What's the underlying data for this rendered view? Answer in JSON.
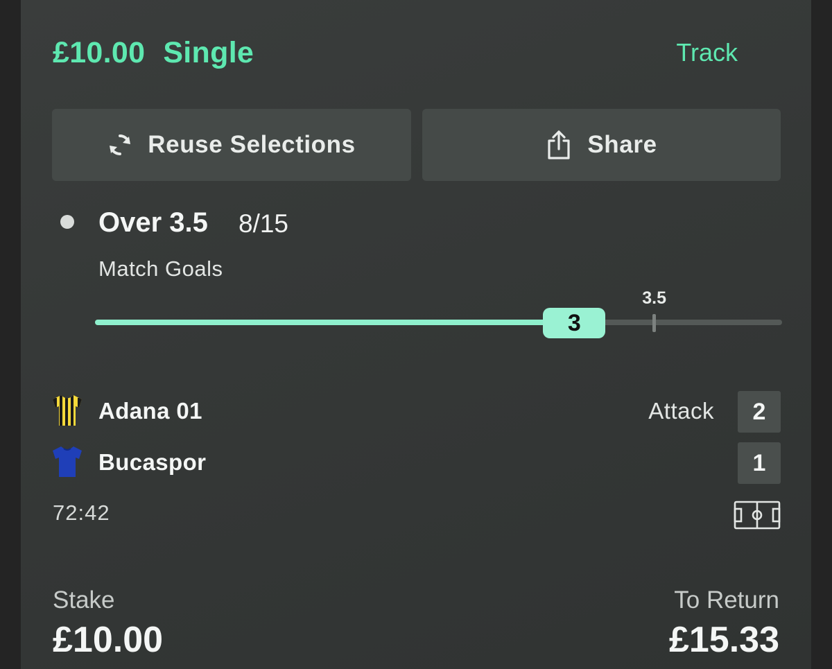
{
  "bet": {
    "stake_amount": "£10.00",
    "bet_type": "Single",
    "track_label": "Track"
  },
  "actions": {
    "reuse_label": "Reuse Selections",
    "share_label": "Share"
  },
  "selection": {
    "name": "Over 3.5",
    "odds": "8/15",
    "market": "Match Goals",
    "progress": {
      "current_value": 3,
      "current_label": "3",
      "threshold_value": 3.5,
      "threshold_label": "3.5",
      "max_value": 4.3
    }
  },
  "match": {
    "home": {
      "name": "Adana 01",
      "score": "2",
      "status": "Attack",
      "shirt_icon": "striped-shirt-icon",
      "shirt_colors": [
        "#f4d83a",
        "#1a1a1a"
      ]
    },
    "away": {
      "name": "Bucaspor",
      "score": "1",
      "shirt_icon": "blue-shirt-icon",
      "shirt_colors": [
        "#1f3fb8"
      ]
    },
    "clock": "72:42",
    "pitch_icon": "pitch-icon"
  },
  "footer": {
    "stake_label": "Stake",
    "stake_value": "£10.00",
    "return_label": "To Return",
    "return_value": "£15.33"
  },
  "colors": {
    "accent": "#5ee8b0",
    "progress_fill": "#8ff0cd",
    "card_bg": "#363938",
    "button_bg": "#454a48"
  }
}
